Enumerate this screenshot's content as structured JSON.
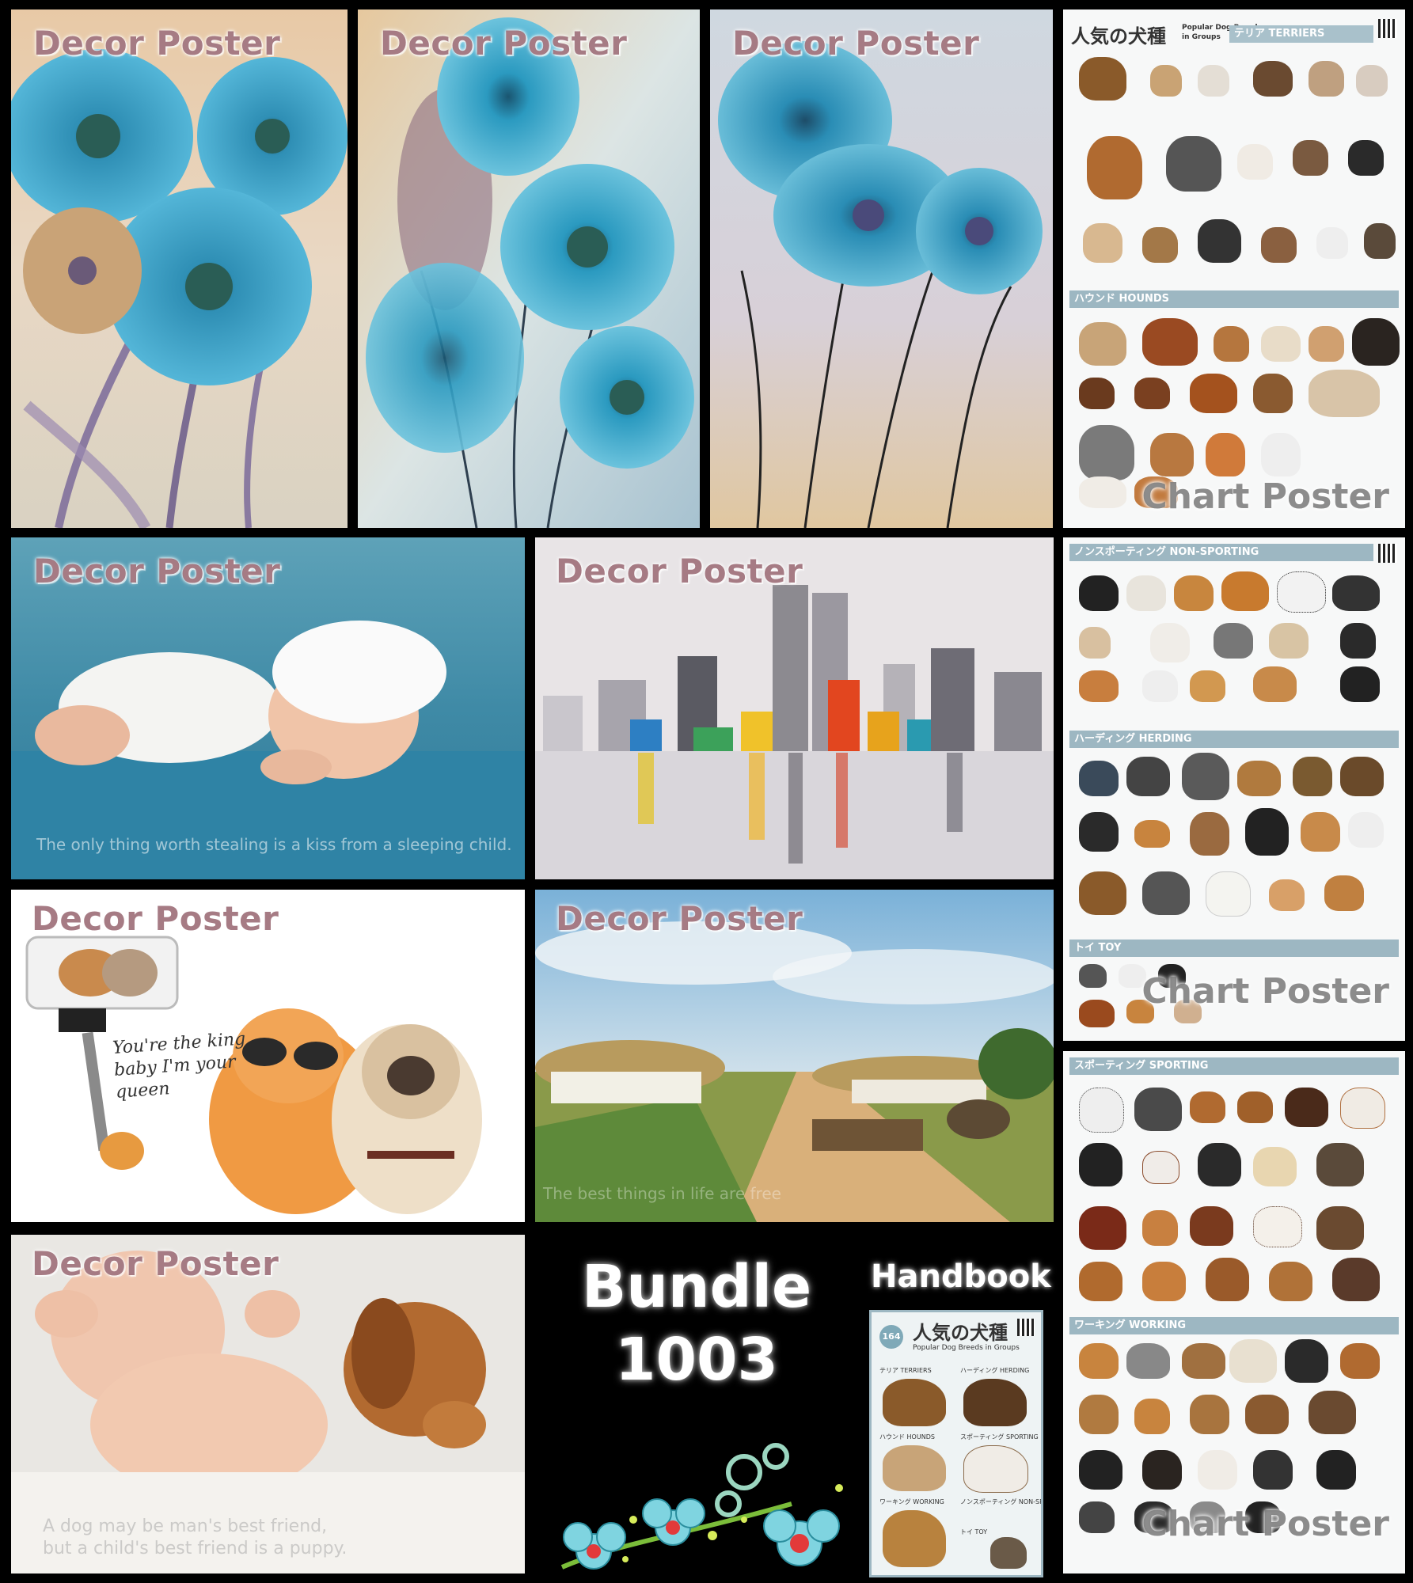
{
  "watermarks": {
    "decor": "Decor Poster",
    "chart": "Chart Poster"
  },
  "captions": {
    "baby_sleeping": "The only thing worth stealing is a kiss from a sleeping child.",
    "cats_script": "You're the king baby I'm your queen",
    "village": "The best things in life are free",
    "baby_puppy_line1": "A dog may be man's best friend,",
    "baby_puppy_line2": "but a child's best friend is a puppy."
  },
  "bundle": {
    "line1": "Bundle",
    "line2": "1003",
    "handbook": "Handbook"
  },
  "chart_poster_1": {
    "title_jp": "人気の犬種",
    "title_en_1": "Popular Dog Breeds",
    "title_en_2": "in Groups",
    "section_terriers": "テリア TERRIERS",
    "section_hounds": "ハウンド HOUNDS"
  },
  "chart_poster_2": {
    "section_nonsporting": "ノンスポーティング NON-SPORTING",
    "section_herding": "ハーディング HERDING",
    "section_toy": "トイ TOY"
  },
  "chart_poster_3": {
    "section_sporting": "スポーティング SPORTING",
    "section_working": "ワーキング WORKING"
  },
  "handbook_cover": {
    "title_jp": "人気の犬種",
    "subtitle": "Popular Dog Breeds in Groups",
    "badge": "164",
    "terriers": "テリア TERRIERS",
    "herding": "ハーディング HERDING",
    "hounds": "ハウンド HOUNDS",
    "sporting": "スポーティング SPORTING",
    "working": "ワーキング WORKING",
    "nonsporting": "ノンスポーティング NON-SPORTING",
    "toy": "トイ TOY"
  },
  "colors": {
    "background": "#000000",
    "watermark": "#96646e",
    "section_header": "#9db7c2",
    "flower_blue": "#3aa3c6"
  }
}
